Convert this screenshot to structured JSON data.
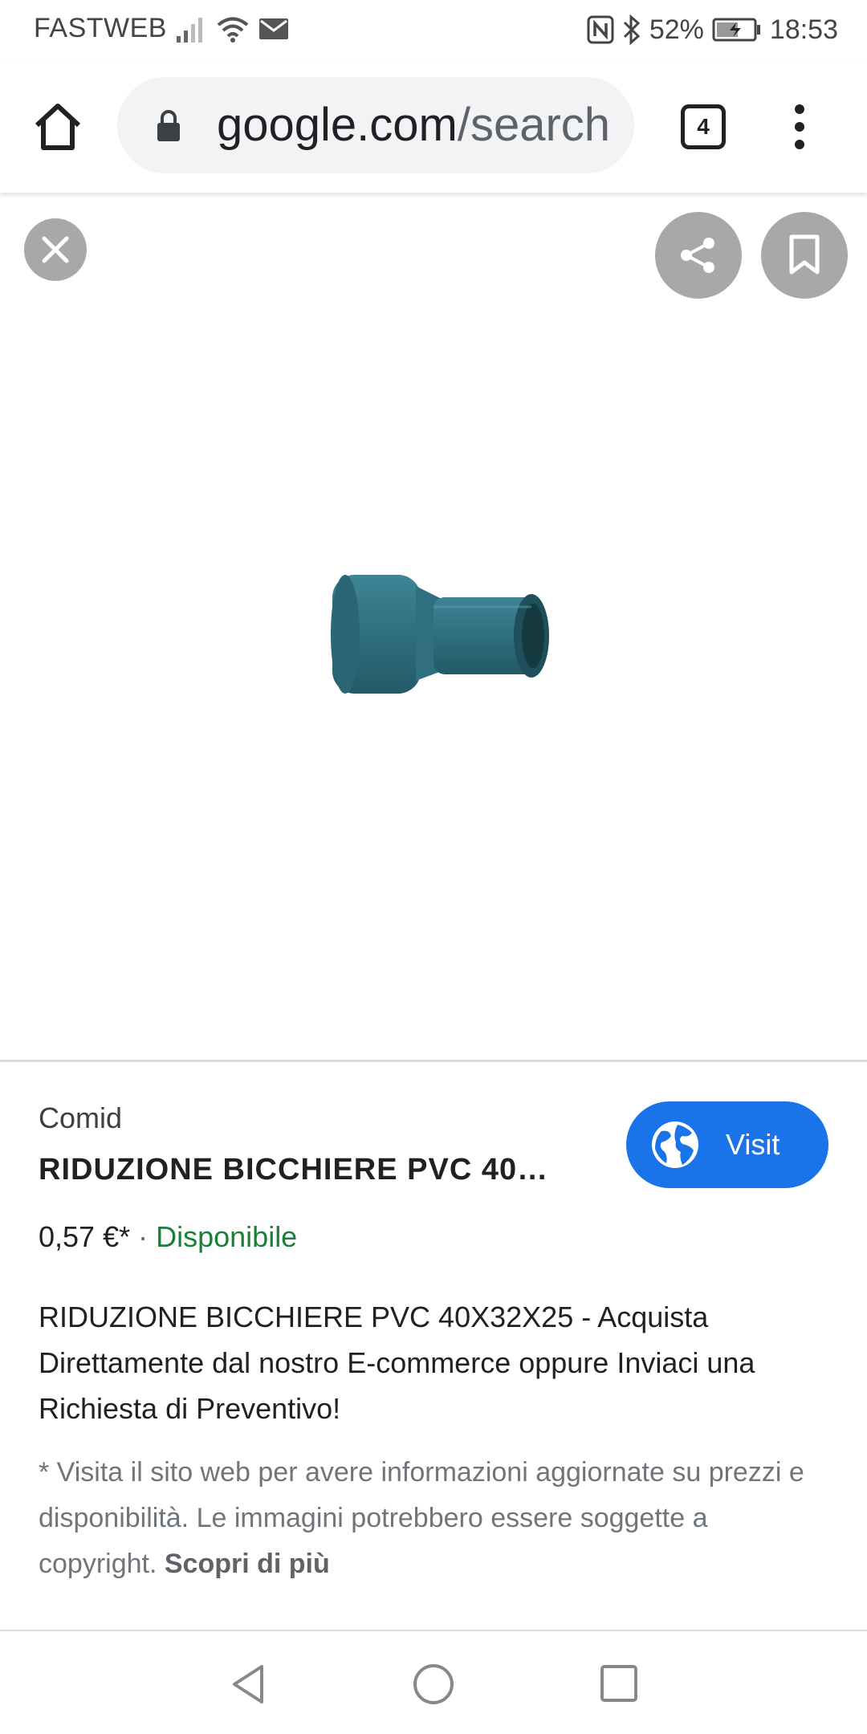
{
  "status_bar": {
    "carrier": "FASTWEB",
    "battery": "52%",
    "time": "18:53",
    "icons": [
      "signal-icon",
      "wifi-icon",
      "mail-icon",
      "nfc-icon",
      "bluetooth-icon",
      "battery-charging-icon"
    ]
  },
  "browser": {
    "url_host": "google.com",
    "url_path": "/search",
    "tab_count": "4"
  },
  "viewer": {
    "image_icon": "pvc-reducer-image"
  },
  "product": {
    "source": "Comid",
    "title": "RIDUZIONE BICCHIERE PVC 40…",
    "price": "0,57 €*",
    "separator": "·",
    "availability": "Disponibile",
    "visit_label": "Visit",
    "description": "RIDUZIONE BICCHIERE PVC 40X32X25 - Acquista Direttamente dal nostro E-commerce oppure Inviaci una Richiesta di Preventivo!",
    "disclaimer": "* Visita il sito web per avere informazioni aggiornate su prezzi e disponibilità. Le immagini potrebbero essere soggette a copyright.",
    "learn_more": "Scopri di più"
  },
  "colors": {
    "accent": "#1a73e8",
    "available_green": "#188038",
    "overlay_button": "#a8a8a8",
    "product_teal": "#2f6f7f"
  }
}
